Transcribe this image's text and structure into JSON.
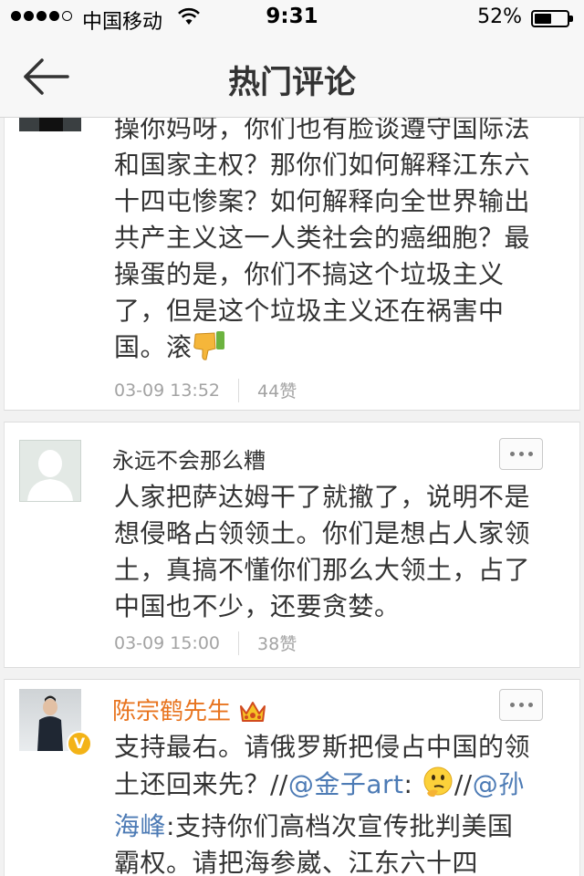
{
  "status_bar": {
    "carrier": "中国移动",
    "time": "9:31",
    "battery_percent": "52%",
    "battery_level": 0.52
  },
  "nav": {
    "title": "热门评论"
  },
  "comments": [
    {
      "author": "",
      "text": "操你妈呀，你们也有脸谈遵守国际法和国家主权？那你们如何解释江东六十四屯惨案？如何解释向全世界输出共产主义这一人类社会的癌细胞？最操蛋的是，你们不搞这个垃圾主义了，但是这个垃圾主义还在祸害中国。滚",
      "emoji": "thumbs-down-icon",
      "date": "03-09 13:52",
      "likes": "44赞"
    },
    {
      "author": "永远不会那么糟",
      "text": "人家把萨达姆干了就撤了，说明不是想侵略占领领土。你们是想占人家领土，真搞不懂你们那么大领土，占了中国也不少，还要贪婪。",
      "date": "03-09 15:00",
      "likes": "38赞"
    },
    {
      "author": "陈宗鹤先生",
      "author_badge": "crown-icon",
      "verified": "V",
      "text_before": "支持最右。请俄罗斯把侵占中国的领土还回来先？//",
      "mention_1": "@金子art",
      "text_mid": ": ",
      "emoji": "thinking-face-icon",
      "text_sep": "//",
      "mention_2": "@孙海峰",
      "text_after": ":支持你们高档次宣传批判美国霸权。请把海参崴、江东六十四"
    }
  ],
  "colors": {
    "accent_orange": "#e8741f",
    "link_blue": "#4d7bb5",
    "meta_gray": "#a3a3a3"
  }
}
